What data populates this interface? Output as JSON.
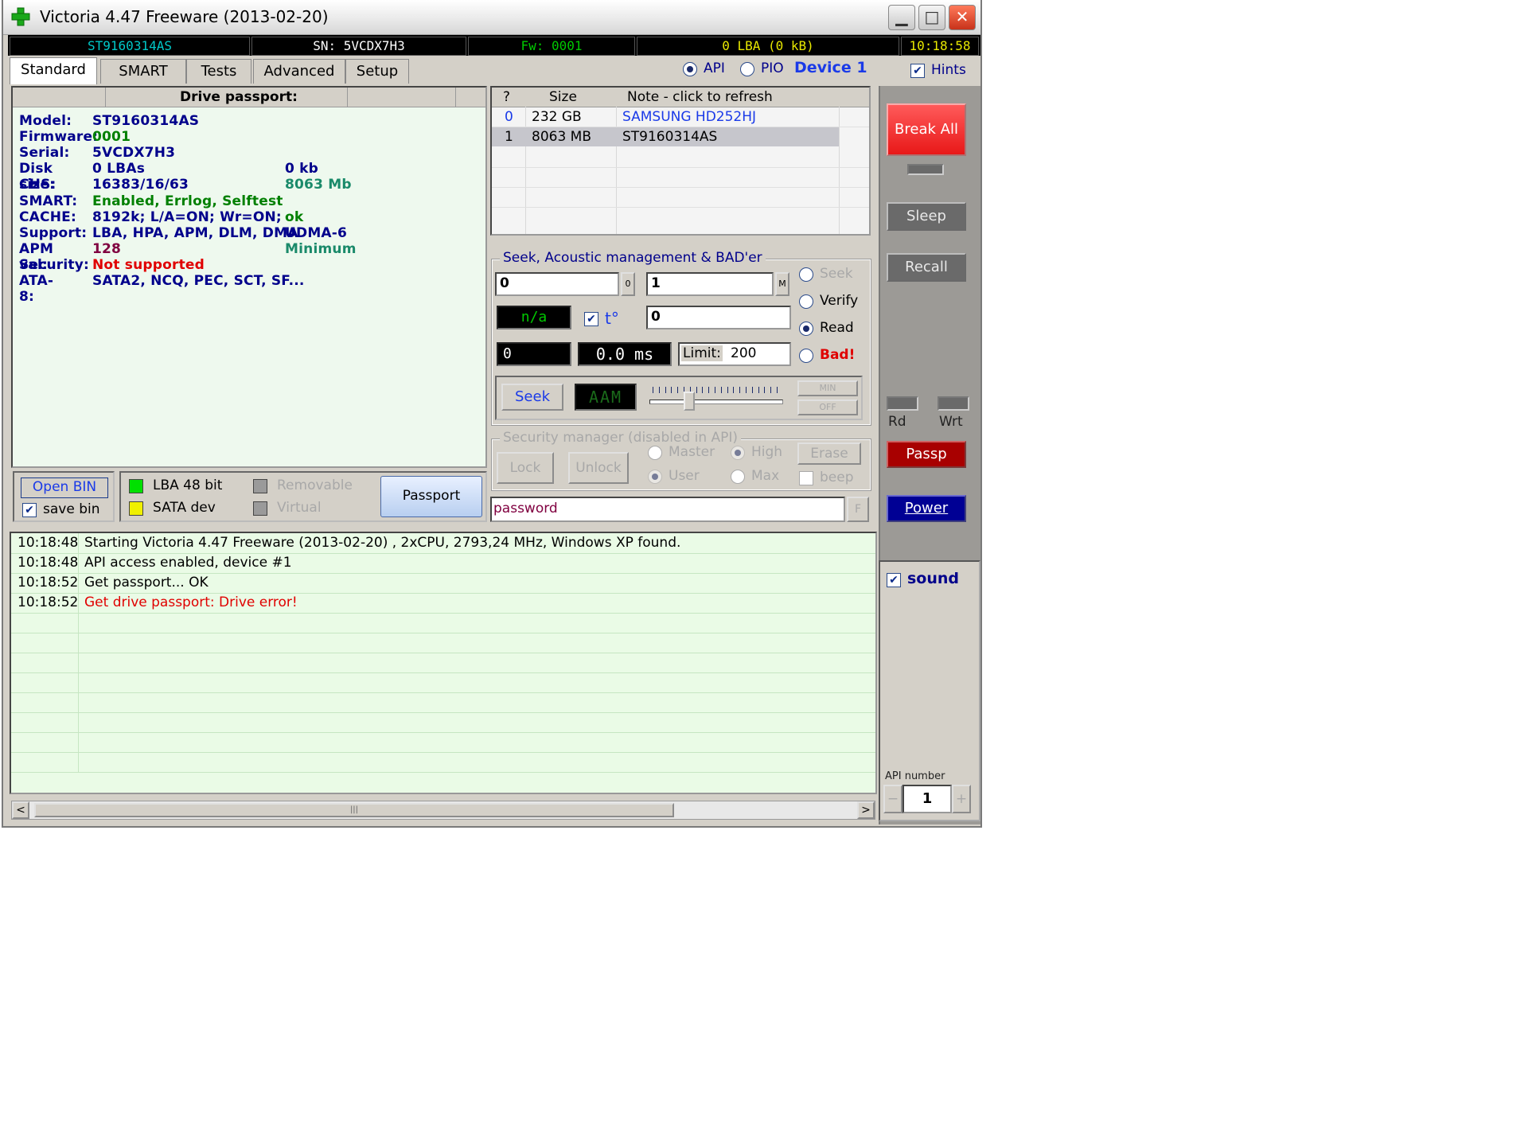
{
  "window": {
    "title": "Victoria 4.47  Freeware (2013-02-20)"
  },
  "status_bar": {
    "model": "ST9160314AS",
    "serial": "SN: 5VCDX7H3",
    "firmware": "Fw: 0001",
    "lba": "0 LBA (0 kB)",
    "clock": "10:18:58"
  },
  "tabs": [
    {
      "label": "Standard",
      "active": true
    },
    {
      "label": "SMART"
    },
    {
      "label": "Tests"
    },
    {
      "label": "Advanced"
    },
    {
      "label": "Setup"
    }
  ],
  "mode": {
    "api_label": "API",
    "pio_label": "PIO",
    "selected": "API",
    "device_label": "Device 1"
  },
  "hints": {
    "label": "Hints",
    "checked": true
  },
  "passport": {
    "header": "Drive passport:",
    "rows": [
      {
        "label": "Model:",
        "value": "ST9160314AS",
        "extra": ""
      },
      {
        "label": "Firmware:",
        "value": "0001",
        "extra": ""
      },
      {
        "label": "Serial:",
        "value": "5VCDX7H3",
        "extra": ""
      },
      {
        "label": "Disk size:",
        "value": "0 LBAs",
        "extra": "0 kb"
      },
      {
        "label": "CHS:",
        "value": "16383/16/63",
        "extra": "8063 Mb"
      },
      {
        "label": "SMART:",
        "value": "Enabled, Errlog, Selftest",
        "extra": ""
      },
      {
        "label": "CACHE:",
        "value": "8192k; L/A=ON; Wr=ON;",
        "extra": "ok"
      },
      {
        "label": "Support:",
        "value": "LBA, HPA, APM, DLM, DMA",
        "extra": "UDMA-6"
      },
      {
        "label": "APM val:",
        "value": "128",
        "extra": "Minimum"
      },
      {
        "label": "Security:",
        "value": "Not supported",
        "extra": ""
      },
      {
        "label": "ATA-8:",
        "value": "SATA2, NCQ, PEC, SCT, SF...",
        "extra": ""
      }
    ]
  },
  "drives": {
    "headers": [
      "?",
      "Size",
      "Note - click to refresh"
    ],
    "rows": [
      {
        "index": "0",
        "size": "232 GB",
        "note": "SAMSUNG HD252HJ"
      },
      {
        "index": "1",
        "size": "8063 MB",
        "note": "ST9160314AS"
      }
    ]
  },
  "seek": {
    "title": "Seek, Acoustic management & BAD'er",
    "from_value": "0",
    "from_btn": "0",
    "to_value": "1",
    "to_btn": "M",
    "temp": "n/a",
    "temp_label": "t°",
    "temp_checked": true,
    "count_value": "0",
    "time_value": "0",
    "ms_value": "0.0 ms",
    "limit_label": "Limit:",
    "limit_value": "200",
    "seek_button": "Seek",
    "aam_display": "AAM",
    "min_button": "MIN",
    "off_button": "OFF",
    "slider_level": 0.28,
    "options": [
      "Seek",
      "Verify",
      "Read",
      "Bad!"
    ],
    "selected_option": "Read"
  },
  "security": {
    "title": "Security manager (disabled in API)",
    "lock": "Lock",
    "unlock": "Unlock",
    "master": "Master",
    "high": "High",
    "user": "User",
    "max": "Max",
    "erase": "Erase",
    "beep": "beep",
    "password_placeholder": "password",
    "f_button": "F"
  },
  "bottom_left": {
    "open_bin": "Open BIN",
    "save_bin": "save bin",
    "save_bin_checked": true,
    "lba48": "LBA 48 bit",
    "sata": "SATA dev",
    "removable": "Removable",
    "virtual": "Virtual",
    "passport_button": "Passport"
  },
  "right_panel": {
    "break_all": "Break All",
    "sleep": "Sleep",
    "recall": "Recall",
    "rd": "Rd",
    "wrt": "Wrt",
    "passp": "Passp",
    "power": "Power",
    "sound": "sound",
    "sound_checked": true,
    "api_number_label": "API number",
    "api_number": "1",
    "minus": "−",
    "plus": "+"
  },
  "log": [
    {
      "time": "10:18:48",
      "message": "Starting Victoria 4.47  Freeware (2013-02-20) , 2xCPU, 2793,24 MHz, Windows XP found.",
      "error": false
    },
    {
      "time": "10:18:48",
      "message": "API access enabled, device #1",
      "error": false
    },
    {
      "time": "10:18:52",
      "message": "Get passport... OK",
      "error": false
    },
    {
      "time": "10:18:52",
      "message": "Get drive passport: Drive error!",
      "error": true
    }
  ],
  "colors": {
    "label_blue": "#00008b",
    "value_green": "#008000",
    "value_teal": "#1a8a6a",
    "error_red": "#e00000",
    "apm_purple": "#800040",
    "status_green": "#00c800",
    "status_yellow": "#e8e800"
  }
}
